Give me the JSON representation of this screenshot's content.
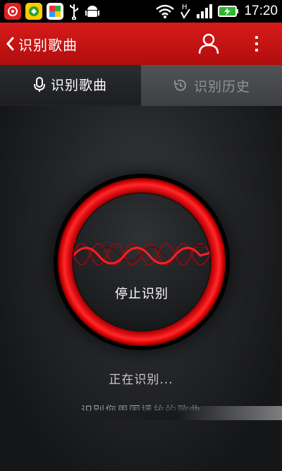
{
  "status_bar": {
    "time": "17:20",
    "apps": [
      {
        "name": "netease-music-app-icon",
        "color": "#e02020"
      },
      {
        "name": "green-app-icon",
        "color": "#2e9e2e"
      },
      {
        "name": "photos-app-icon",
        "color": "#ffffff"
      }
    ]
  },
  "action_bar": {
    "title": "识别歌曲"
  },
  "tabs": [
    {
      "label": "识别歌曲",
      "icon": "microphone-icon",
      "active": true
    },
    {
      "label": "识别历史",
      "icon": "history-icon",
      "active": false
    }
  ],
  "recognizer": {
    "stop_label": "停止识别",
    "status": "正在识别...",
    "hint": "识别您周围播放的歌曲"
  },
  "colors": {
    "accent": "#d81b1b",
    "ring": "#e8141a"
  }
}
